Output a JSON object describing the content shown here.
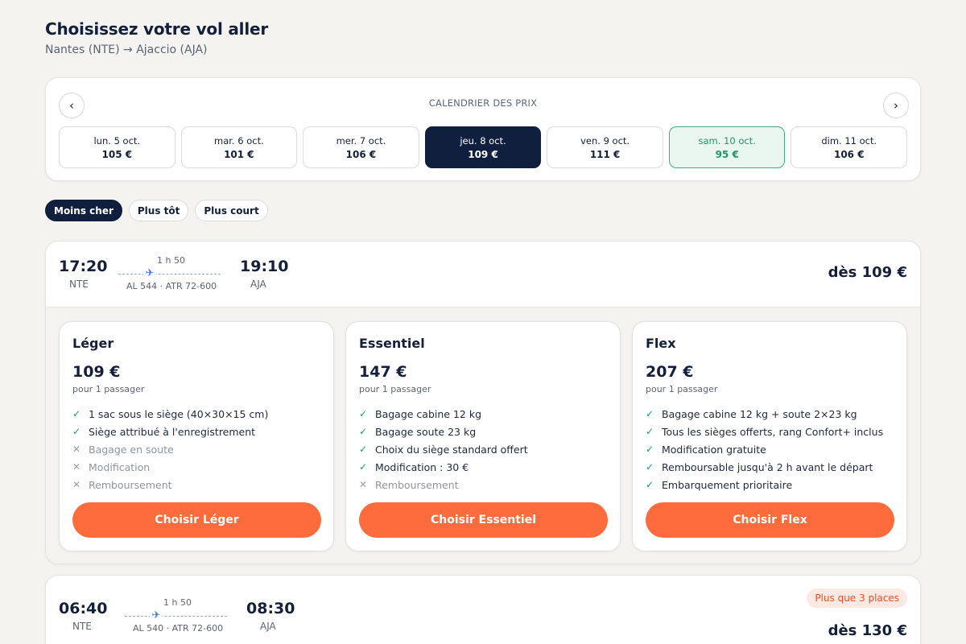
{
  "header": {
    "title": "Choisissez votre vol aller",
    "route": "Nantes (NTE) → Ajaccio (AJA)"
  },
  "calendar": {
    "title": "CALENDRIER DES PRIX",
    "prev_icon": "chevron-left-icon",
    "next_icon": "chevron-right-icon",
    "days": [
      {
        "label": "lun. 5 oct.",
        "price": "105 €",
        "state": "default"
      },
      {
        "label": "mar. 6 oct.",
        "price": "101 €",
        "state": "default"
      },
      {
        "label": "mer. 7 oct.",
        "price": "106 €",
        "state": "default"
      },
      {
        "label": "jeu. 8 oct.",
        "price": "109 €",
        "state": "selected"
      },
      {
        "label": "ven. 9 oct.",
        "price": "111 €",
        "state": "default"
      },
      {
        "label": "sam. 10 oct.",
        "price": "95 €",
        "state": "cheapest"
      },
      {
        "label": "dim. 11 oct.",
        "price": "106 €",
        "state": "default"
      }
    ]
  },
  "filters": [
    {
      "label": "Moins cher",
      "active": true
    },
    {
      "label": "Plus tôt",
      "active": false
    },
    {
      "label": "Plus court",
      "active": false
    }
  ],
  "flights": [
    {
      "depart_time": "17:20",
      "depart_airport": "NTE",
      "arrive_time": "19:10",
      "arrive_airport": "AJA",
      "duration": "1 h 50",
      "flight_info": "AL 544 · ATR 72-600",
      "from_price": "dès 109 €",
      "fares": [
        {
          "name": "Léger",
          "price": "109 €",
          "per": "pour 1 passager",
          "features": [
            {
              "text": "1 sac sous le siège (40×30×15 cm)",
              "included": true
            },
            {
              "text": "Siège attribué à l'enregistrement",
              "included": true
            },
            {
              "text": "Bagage en soute",
              "included": false
            },
            {
              "text": "Modification",
              "included": false
            },
            {
              "text": "Remboursement",
              "included": false
            }
          ],
          "button": "Choisir Léger"
        },
        {
          "name": "Essentiel",
          "price": "147 €",
          "per": "pour 1 passager",
          "features": [
            {
              "text": "Bagage cabine 12 kg",
              "included": true
            },
            {
              "text": "Bagage soute 23 kg",
              "included": true
            },
            {
              "text": "Choix du siège standard offert",
              "included": true
            },
            {
              "text": "Modification : 30 €",
              "included": true
            },
            {
              "text": "Remboursement",
              "included": false
            }
          ],
          "button": "Choisir Essentiel"
        },
        {
          "name": "Flex",
          "price": "207 €",
          "per": "pour 1 passager",
          "features": [
            {
              "text": "Bagage cabine 12 kg + soute 2×23 kg",
              "included": true
            },
            {
              "text": "Tous les sièges offerts, rang Confort+ inclus",
              "included": true
            },
            {
              "text": "Modification gratuite",
              "included": true
            },
            {
              "text": "Remboursable jusqu'à 2 h avant le départ",
              "included": true
            },
            {
              "text": "Embarquement prioritaire",
              "included": true
            }
          ],
          "button": "Choisir Flex"
        }
      ]
    },
    {
      "depart_time": "06:40",
      "depart_airport": "NTE",
      "arrive_time": "08:30",
      "arrive_airport": "AJA",
      "duration": "1 h 50",
      "flight_info": "AL 540 · ATR 72-600",
      "badge": "Plus que 3 places",
      "from_price": "dès 130 €"
    }
  ],
  "colors": {
    "primary": "#0f1f3d",
    "accent": "#fe6b3d",
    "success": "#1f9b69",
    "cheapest_bg": "#eaf7f1",
    "badge_bg": "#fde9e2",
    "badge_text": "#e4502a"
  }
}
